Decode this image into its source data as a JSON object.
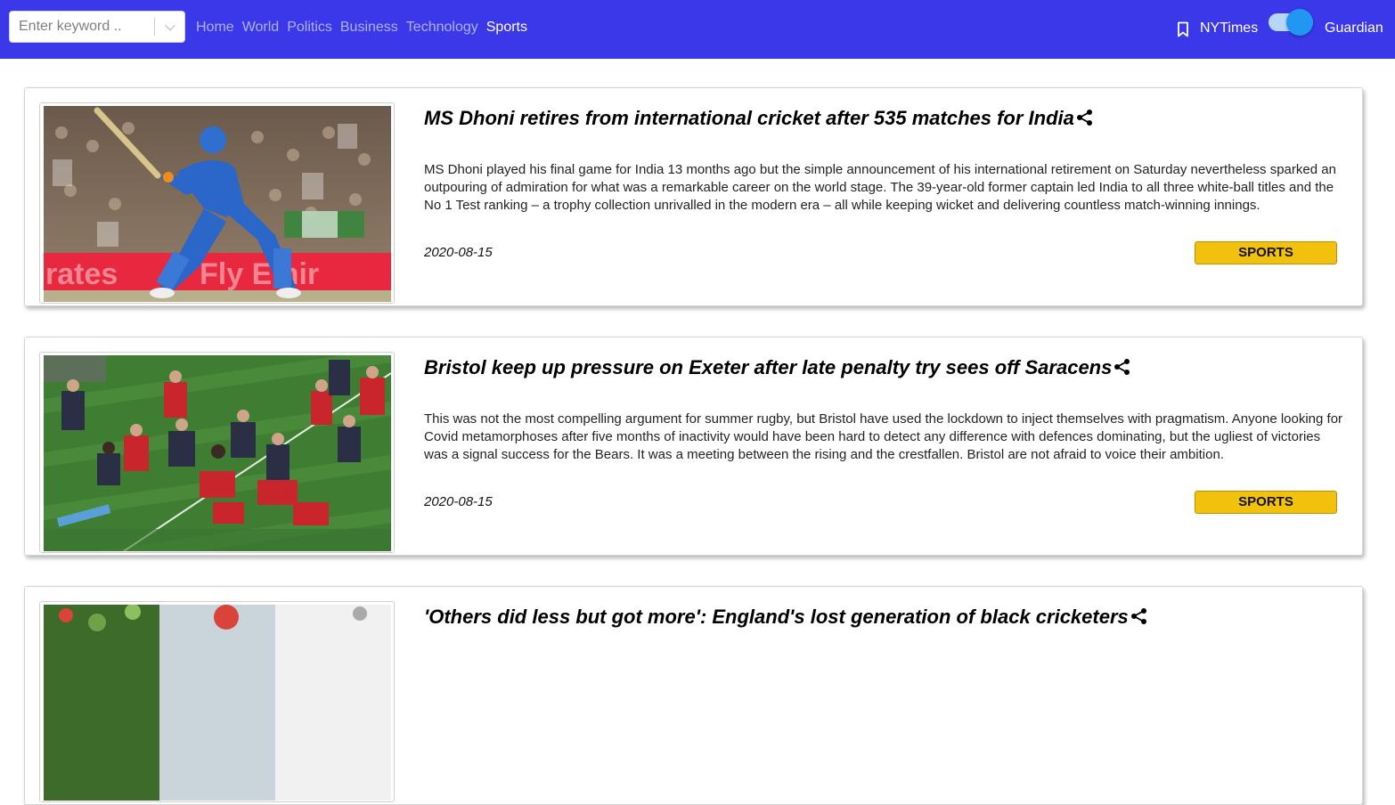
{
  "search": {
    "placeholder": "Enter keyword ..",
    "value": ""
  },
  "nav": {
    "links": [
      "Home",
      "World",
      "Politics",
      "Business",
      "Technology",
      "Sports"
    ],
    "active": "Sports",
    "source_left": "NYTimes",
    "source_right": "Guardian",
    "toggle_on": true,
    "color_navbar": "#3a38e8",
    "color_toggle": "#2196f3"
  },
  "articles": [
    {
      "title": "MS Dhoni retires from international cricket after 535 matches for India",
      "description": "MS Dhoni played his final game for India 13 months ago but the simple announcement of his international retirement on Saturday nevertheless sparked an outpouring of admiration for what was a remarkable career on the world stage. The 39-year-old former captain led India to all three white-ball titles and the No 1 Test ranking – a trophy collection unrivalled in the modern era – all while keeping wicket and delivering countless match-winning innings.",
      "date": "2020-08-15",
      "section": "SPORTS"
    },
    {
      "title": "Bristol keep up pressure on Exeter after late penalty try sees off Saracens",
      "description": "This was not the most compelling argument for summer rugby, but Bristol have used the lockdown to inject themselves with pragmatism. Anyone looking for Covid metamorphoses after five months of inactivity would have been hard to detect any difference with defences dominating, but the ugliest of victories was a signal success for the Bears. It was a meeting between the rising and the crestfallen. Bristol are not afraid to voice their ambition.",
      "date": "2020-08-15",
      "section": "SPORTS"
    },
    {
      "title": "'Others did less but got more': England's lost generation of black cricketers",
      "description": "",
      "date": "",
      "section": ""
    }
  ],
  "colors": {
    "badge": "#f2c10d"
  }
}
